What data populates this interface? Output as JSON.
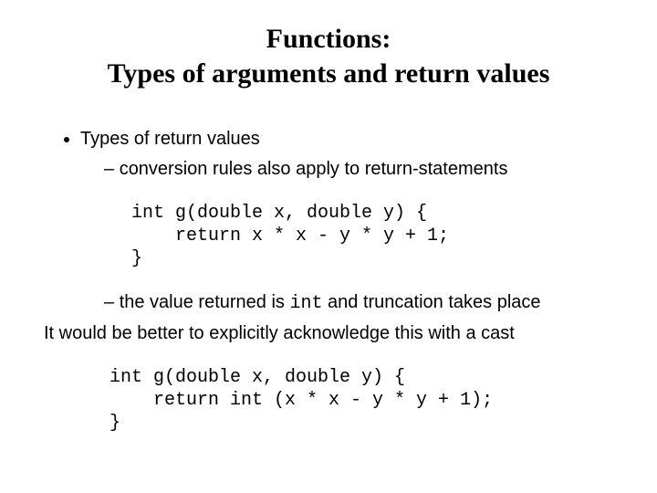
{
  "title_line1": "Functions:",
  "title_line2": "Types of arguments and return values",
  "bullet1": "Types of return values",
  "sub1": "conversion rules also apply to return-statements",
  "code1": "int g(double x, double y) {\n    return x * x - y * y + 1;\n}",
  "sub2_a": "the value returned is ",
  "sub2_code": "int",
  "sub2_b": " and truncation takes place",
  "para": "It would be better to explicitly acknowledge this with a cast",
  "code2": "int g(double x, double y) {\n    return int (x * x - y * y + 1);\n}"
}
